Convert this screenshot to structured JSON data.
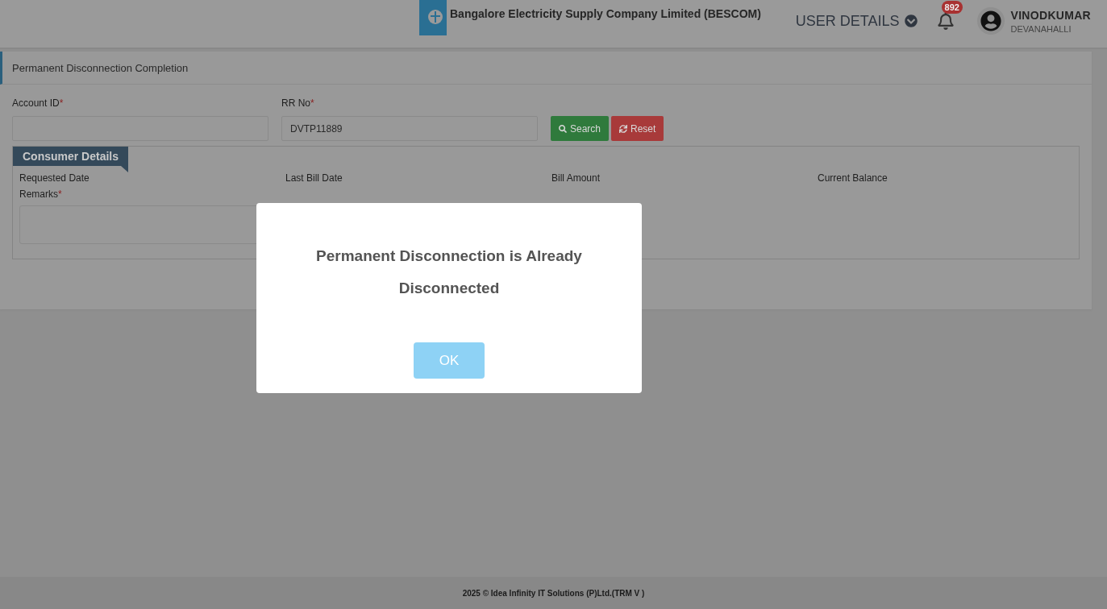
{
  "header": {
    "company": "Bangalore Electricity Supply Company Limited (BESCOM)",
    "user_menu": "USER DETAILS",
    "notification_count": "892",
    "user_name": "VINODKUMAR",
    "user_location": "DEVANAHALLI"
  },
  "page_title": "Permanent Disconnection Completion",
  "fields": [
    {
      "label": "Account ID",
      "mark": "*"
    },
    {
      "label": "RR No",
      "mark": "*",
      "value": "DVTP11889"
    }
  ],
  "buttons": [
    {
      "kind": "search",
      "label": "Search"
    },
    {
      "kind": "reset",
      "label": "Reset"
    }
  ],
  "consumer_details": {
    "title": "Consumer Details",
    "columns": [
      "Requested Date",
      "Last Bill Date",
      "Bill Amount",
      "Current Balance"
    ],
    "remarks": {
      "label": "Remarks",
      "mark": "*"
    }
  },
  "dialog": {
    "message": "Permanent Disconnection is Already Disconnected",
    "button": "OK"
  },
  "footer": "2025 © Idea Infinity IT Solutions (P)Ltd.(TRM V )"
}
